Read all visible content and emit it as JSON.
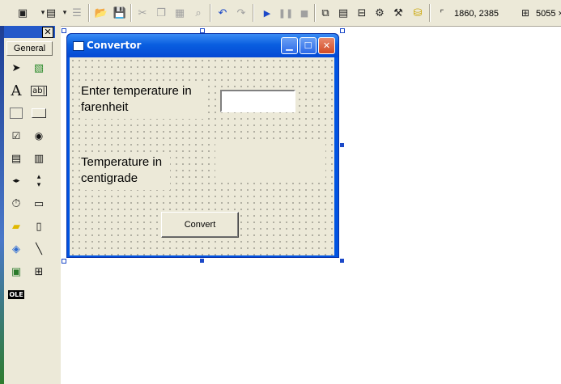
{
  "toolbar": {
    "position_readout": "1860, 2385",
    "size_readout": "5055 ×",
    "icons": [
      "add-project-icon",
      "add-form-icon",
      "menu-editor-icon",
      "open-icon",
      "save-icon",
      "cut-icon",
      "copy-icon",
      "paste-icon",
      "find-icon",
      "undo-icon",
      "redo-icon",
      "start-icon",
      "break-icon",
      "end-icon",
      "project-explorer-icon",
      "properties-icon",
      "form-layout-icon",
      "object-browser-icon",
      "toolbox-icon",
      "data-view-icon"
    ]
  },
  "toolbox": {
    "close_glyph": "✕",
    "tab_label": "General",
    "tools": [
      "pointer",
      "picture-box",
      "label",
      "text-box",
      "frame",
      "command-button",
      "check-box",
      "option-button",
      "combo-box",
      "list-box",
      "hscroll-bar",
      "vscroll-bar",
      "timer",
      "drive-list-box",
      "dir-list-box",
      "file-list-box",
      "shape",
      "line",
      "image",
      "data",
      "ole"
    ]
  },
  "form": {
    "title": "Convertor",
    "label_fahrenheit": "Enter temperature in farenheit",
    "fahrenheit_input_value": "",
    "label_centigrade": "Temperature in centigrade",
    "result_value": "",
    "convert_button": "Convert"
  }
}
